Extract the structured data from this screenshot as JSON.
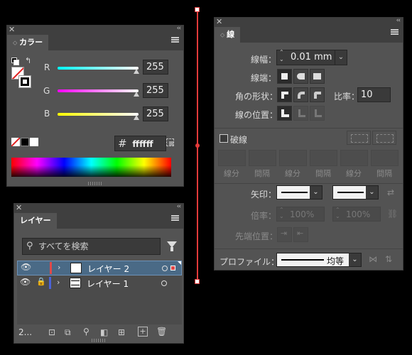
{
  "color_panel": {
    "tab": "カラー",
    "channels": [
      {
        "label": "R",
        "value": "255",
        "gradient": [
          "#00ffff",
          "#ffffff"
        ]
      },
      {
        "label": "G",
        "value": "255",
        "gradient": [
          "#ff00ff",
          "#ffffff"
        ]
      },
      {
        "label": "B",
        "value": "255",
        "gradient": [
          "#ffff00",
          "#ffffff"
        ]
      }
    ],
    "hex_prefix": "#",
    "hex_value": "ffffff"
  },
  "layers_panel": {
    "tab": "レイヤー",
    "search_placeholder": "すべてを検索",
    "layers": [
      {
        "name": "レイヤー 2",
        "color": "#e04a4a",
        "selected": true
      },
      {
        "name": "レイヤー 1",
        "color": "#4b63d8",
        "selected": false,
        "locked": true
      }
    ],
    "count_label": "2..."
  },
  "stroke_panel": {
    "tab": "線",
    "weight_label": "線幅：",
    "weight_value": "0.01 mm",
    "cap_label": "線端：",
    "corner_label": "角の形状：",
    "ratio_label": "比率：",
    "ratio_value": "10",
    "align_label": "線の位置：",
    "dashed_label": "破線",
    "dash_fields": [
      "線分",
      "間隔",
      "線分",
      "間隔",
      "線分",
      "間隔"
    ],
    "arrow_label": "矢印：",
    "scale_label": "倍率：",
    "scale_values": [
      "100%",
      "100%"
    ],
    "tip_label": "先端位置：",
    "profile_label": "プロファイル：",
    "profile_value": "均等"
  },
  "colors": {
    "panel_bg": "#535353",
    "tab_strip": "#3f3f3f",
    "guide_line": "#e23a3a",
    "selection_row": "#4a6a86"
  }
}
